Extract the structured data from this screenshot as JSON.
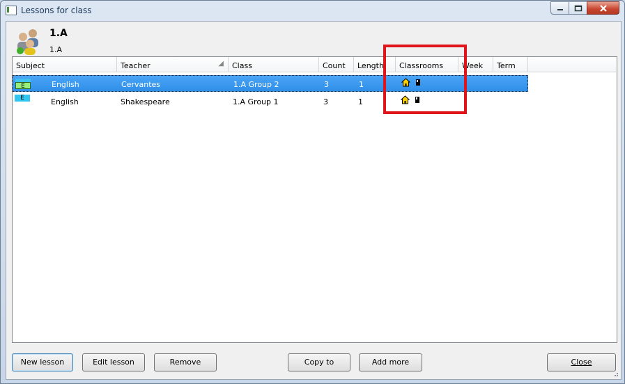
{
  "window": {
    "title": "Lessons for class"
  },
  "header": {
    "title": "1.A",
    "subtitle": "1.A"
  },
  "table": {
    "columns": [
      "Subject",
      "Teacher",
      "Class",
      "Count",
      "Length",
      "Classrooms",
      "Week",
      "Term"
    ],
    "rows": [
      {
        "subject_chip": "E",
        "subject": "English",
        "teacher": "Cervantes",
        "class": "1.A Group 2",
        "count": "3",
        "length": "1",
        "classroom_icons": [
          "home-icon",
          "classroom-icon"
        ],
        "week": "",
        "term": "",
        "selected": true
      },
      {
        "subject_chip": "E",
        "subject": "English",
        "teacher": "Shakespeare",
        "class": "1.A Group 1",
        "count": "3",
        "length": "1",
        "classroom_icons": [
          "home-icon",
          "classroom-icon"
        ],
        "week": "",
        "term": "",
        "selected": false
      }
    ]
  },
  "buttons": {
    "new_lesson": "New lesson",
    "edit_lesson": "Edit lesson",
    "remove": "Remove",
    "copy_to": "Copy to",
    "add_more": "Add more",
    "close": "Close"
  },
  "colors": {
    "selection": "#3399ff",
    "highlight_box": "#e0151c",
    "chip_green": "#98f07c",
    "chip_cyan": "#30c6f0"
  }
}
